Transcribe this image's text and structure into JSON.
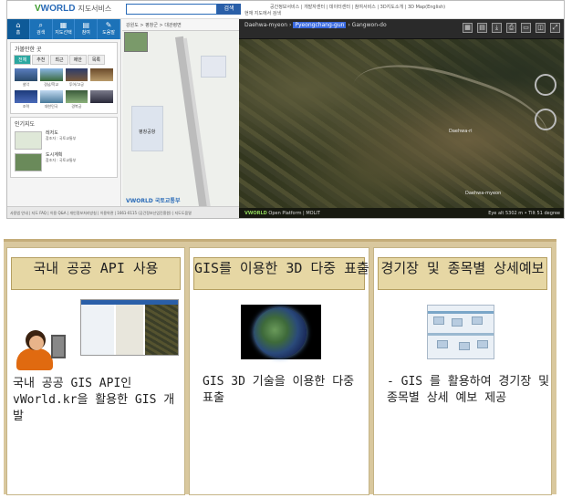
{
  "screenshot": {
    "logo_prefix": "V",
    "logo_name": "WORLD",
    "logo_service": "지도서비스",
    "search_button": "검색",
    "search_option": "현재 지도에서 검색",
    "top_nav": "공간정보서비스 | 개발자센터 | 데이터센터 | 참여서비스 | 3D지도소개 | 3D Map(English)",
    "left_menu": [
      {
        "icon": "home-icon",
        "glyph": "⌂",
        "label": "홈"
      },
      {
        "icon": "search-icon",
        "glyph": "⌕",
        "label": "검색"
      },
      {
        "icon": "map-icon",
        "glyph": "▦",
        "label": "지도선택"
      },
      {
        "icon": "layer-icon",
        "glyph": "▤",
        "label": "참여"
      },
      {
        "icon": "tools-icon",
        "glyph": "✎",
        "label": "도움말"
      }
    ],
    "popular_title": "가볼만한 곳",
    "popular_tabs": [
      "전체",
      "추천",
      "최근",
      "제안",
      "목록"
    ],
    "popular_captions": [
      "설악",
      "경남/학교",
      "투어/고궁",
      "",
      "조력",
      "대한민국",
      "경복궁",
      ""
    ],
    "thematic_title": "인기지도",
    "thematic_items": [
      {
        "name": "레저도",
        "meta": "참조자 : 국토교통부"
      },
      {
        "name": "도시계획",
        "meta": "참조자 : 국토교통부"
      }
    ],
    "map2d_breadcrumb": "강원도 > 평창군 > 대관령면",
    "map2d_place": "평창공항",
    "map2d_brand": "VWORLD 국토교통부",
    "map3d_breadcrumb_1": "Daehwa-myeon",
    "map3d_breadcrumb_2": "Pyeongchang-gun",
    "map3d_breadcrumb_3": "Gangwon-do",
    "map3d_label_1": "Daehwa-ri",
    "map3d_label_2": "Daehwa-myeon",
    "map3d_brand": "VWORLD",
    "map3d_footer": "Open Platform  |  MOLIT",
    "map3d_eye_alt": "Eye alt 5302 m  •  Tilt 51 degree",
    "statusbar": "사용법 안내 | 지도 FAQ | 이용 Q&A | 개인정보처리방침 | 이용약관 | 1661-0115 (공간정보산업진흥원) | 지도도움말"
  },
  "panels": [
    {
      "header": "국내 공공 API 사용",
      "description": "국내 공공 GIS API인 vWorld.kr을 활용한 GIS 개발"
    },
    {
      "header": "GIS를 이용한 3D 다중 표출",
      "description": "GIS 3D 기술을 이용한 다중 표출"
    },
    {
      "header": "경기장 및 종목별 상세예보",
      "description": "- GIS 를 활용하여 경기장 및 종목별 상세 예보 제공"
    }
  ]
}
